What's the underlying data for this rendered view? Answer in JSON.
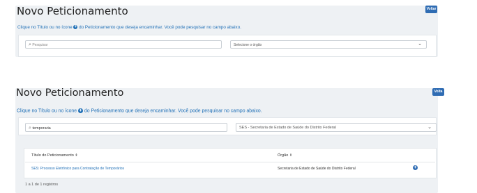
{
  "screen1": {
    "title": "Novo Peticionamento",
    "voltar_label": "Voltar",
    "instruction_before": "Clique no Título ou no ícone",
    "instruction_after": "do Peticionamento que deseja encaminhar. Você pode pesquisar no campo abaixo.",
    "search_placeholder": "Pesquisar",
    "orgao_value": "Selecione o órgão"
  },
  "screen2": {
    "title": "Novo Peticionamento",
    "voltar_label": "Volta",
    "instruction_before": "Clique no Título ou no ícone",
    "instruction_after": "do Peticionamento que deseja encaminhar. Você pode pesquisar no campo abaixo.",
    "search_value": "temporaria",
    "orgao_value": "SES - Secretaria de Estado de Saúde do Distrito Federal",
    "table": {
      "headers": [
        "Título do Peticionamento",
        "Órgão"
      ],
      "rows": [
        [
          "SES: Processo Eletrônico para Contratação de Temporários",
          "Secretaria de Estado de Saúde do Distrito Federal"
        ]
      ]
    },
    "footer": "1 a 1 de 1 registros"
  },
  "icons": {
    "plus": "+",
    "sort": "⇕",
    "search": "⌕",
    "chevron": "⌄"
  },
  "colors": {
    "accent": "#2f6cb3",
    "link": "#1f6fb6",
    "panel": "#eef1f4"
  }
}
